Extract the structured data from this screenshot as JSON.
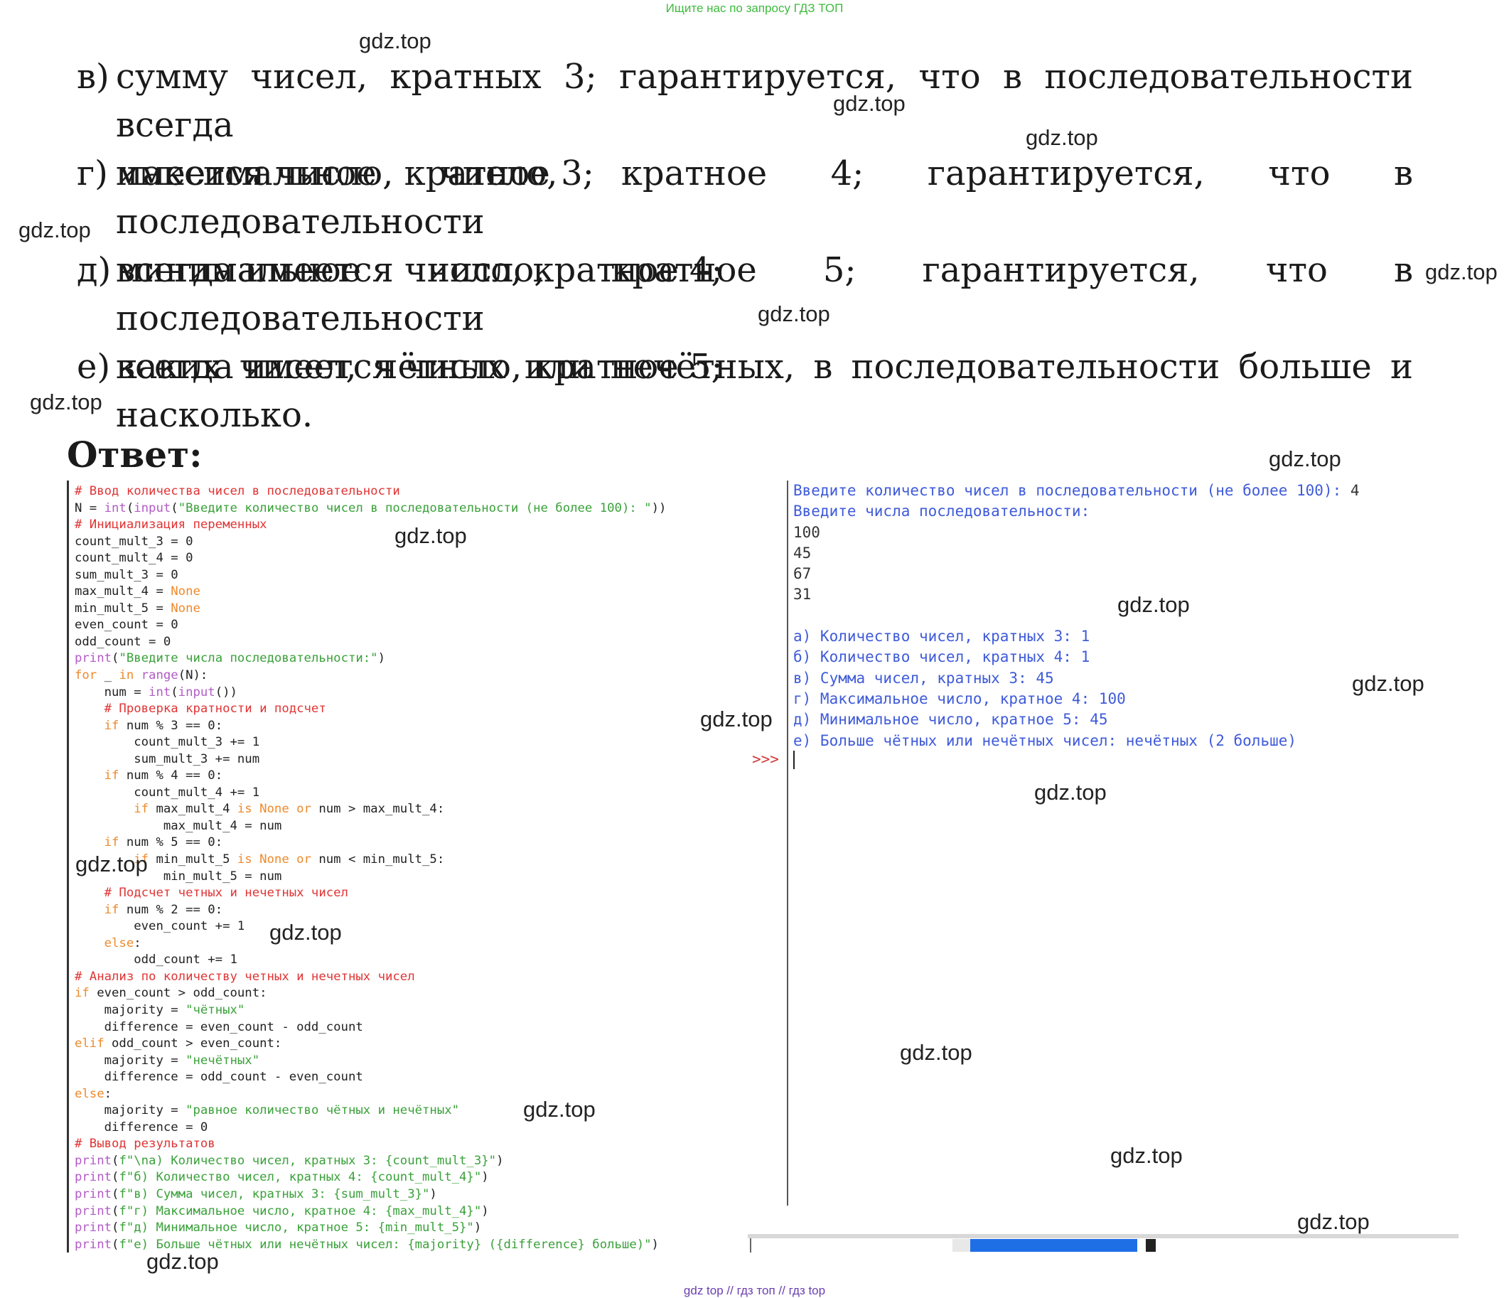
{
  "banner": "Ищите нас по запросу ГДЗ ТОП",
  "tasks": [
    {
      "label": "в)",
      "line1": "сумму чисел, кратных 3; гарантируется, что в последовательности всегда",
      "line2": "имеется число, кратное 3;"
    },
    {
      "label": "г)",
      "line1": "максимальное число, кратное 4; гарантируется, что в последовательности",
      "line2": "всегда имеется число, кратное 4;"
    },
    {
      "label": "д)",
      "line1": "минимальное число, кратное 5; гарантируется, что в последовательности",
      "line2": "всегда имеется число, кратное 5;"
    },
    {
      "label": "е)",
      "line1": "каких чисел, чётных или нечётных, в последовательности больше и",
      "line2": "насколько."
    }
  ],
  "answer_heading": "Ответ:",
  "code": [
    [
      {
        "t": "# Ввод количества чисел в последовательности",
        "c": "com"
      }
    ],
    [
      {
        "t": "N = ",
        "c": ""
      },
      {
        "t": "int",
        "c": "bi"
      },
      {
        "t": "(",
        "c": ""
      },
      {
        "t": "input",
        "c": "bi"
      },
      {
        "t": "(",
        "c": ""
      },
      {
        "t": "\"Введите количество чисел в последовательности (не более 100): \"",
        "c": "str"
      },
      {
        "t": "))",
        "c": ""
      }
    ],
    [
      {
        "t": "# Инициализация переменных",
        "c": "com"
      }
    ],
    [
      {
        "t": "count_mult_3 = 0",
        "c": ""
      }
    ],
    [
      {
        "t": "count_mult_4 = 0",
        "c": ""
      }
    ],
    [
      {
        "t": "sum_mult_3 = 0",
        "c": ""
      }
    ],
    [
      {
        "t": "max_mult_4 = ",
        "c": ""
      },
      {
        "t": "None",
        "c": "none"
      }
    ],
    [
      {
        "t": "min_mult_5 = ",
        "c": ""
      },
      {
        "t": "None",
        "c": "none"
      }
    ],
    [
      {
        "t": "even_count = 0",
        "c": ""
      }
    ],
    [
      {
        "t": "odd_count = 0",
        "c": ""
      }
    ],
    [
      {
        "t": "print",
        "c": "bi"
      },
      {
        "t": "(",
        "c": ""
      },
      {
        "t": "\"Введите числа последовательности:\"",
        "c": "str"
      },
      {
        "t": ")",
        "c": ""
      }
    ],
    [
      {
        "t": "for",
        "c": "kw"
      },
      {
        "t": " _ ",
        "c": ""
      },
      {
        "t": "in",
        "c": "kw"
      },
      {
        "t": " ",
        "c": ""
      },
      {
        "t": "range",
        "c": "bi"
      },
      {
        "t": "(N):",
        "c": ""
      }
    ],
    [
      {
        "t": "    num = ",
        "c": ""
      },
      {
        "t": "int",
        "c": "bi"
      },
      {
        "t": "(",
        "c": ""
      },
      {
        "t": "input",
        "c": "bi"
      },
      {
        "t": "())",
        "c": ""
      }
    ],
    [
      {
        "t": "    # Проверка кратности и подсчет",
        "c": "com"
      }
    ],
    [
      {
        "t": "    ",
        "c": ""
      },
      {
        "t": "if",
        "c": "kw"
      },
      {
        "t": " num % 3 == 0:",
        "c": ""
      }
    ],
    [
      {
        "t": "        count_mult_3 += 1",
        "c": ""
      }
    ],
    [
      {
        "t": "        sum_mult_3 += num",
        "c": ""
      }
    ],
    [
      {
        "t": "    ",
        "c": ""
      },
      {
        "t": "if",
        "c": "kw"
      },
      {
        "t": " num % 4 == 0:",
        "c": ""
      }
    ],
    [
      {
        "t": "        count_mult_4 += 1",
        "c": ""
      }
    ],
    [
      {
        "t": "        ",
        "c": ""
      },
      {
        "t": "if",
        "c": "kw"
      },
      {
        "t": " max_mult_4 ",
        "c": ""
      },
      {
        "t": "is None or",
        "c": "kw"
      },
      {
        "t": " num > max_mult_4:",
        "c": ""
      }
    ],
    [
      {
        "t": "            max_mult_4 = num",
        "c": ""
      }
    ],
    [
      {
        "t": "    ",
        "c": ""
      },
      {
        "t": "if",
        "c": "kw"
      },
      {
        "t": " num % 5 == 0:",
        "c": ""
      }
    ],
    [
      {
        "t": "        ",
        "c": ""
      },
      {
        "t": "if",
        "c": "kw"
      },
      {
        "t": " min_mult_5 ",
        "c": ""
      },
      {
        "t": "is None or",
        "c": "kw"
      },
      {
        "t": " num < min_mult_5:",
        "c": ""
      }
    ],
    [
      {
        "t": "            min_mult_5 = num",
        "c": ""
      }
    ],
    [
      {
        "t": "    # Подсчет четных и нечетных чисел",
        "c": "com"
      }
    ],
    [
      {
        "t": "    ",
        "c": ""
      },
      {
        "t": "if",
        "c": "kw"
      },
      {
        "t": " num % 2 == 0:",
        "c": ""
      }
    ],
    [
      {
        "t": "        even_count += 1",
        "c": ""
      }
    ],
    [
      {
        "t": "    ",
        "c": ""
      },
      {
        "t": "else",
        "c": "kw"
      },
      {
        "t": ":",
        "c": ""
      }
    ],
    [
      {
        "t": "        odd_count += 1",
        "c": ""
      }
    ],
    [
      {
        "t": "# Анализ по количеству четных и нечетных чисел",
        "c": "com"
      }
    ],
    [
      {
        "t": "if",
        "c": "kw"
      },
      {
        "t": " even_count > odd_count:",
        "c": ""
      }
    ],
    [
      {
        "t": "    majority = ",
        "c": ""
      },
      {
        "t": "\"чётных\"",
        "c": "str"
      }
    ],
    [
      {
        "t": "    difference = even_count - odd_count",
        "c": ""
      }
    ],
    [
      {
        "t": "elif",
        "c": "kw"
      },
      {
        "t": " odd_count > even_count:",
        "c": ""
      }
    ],
    [
      {
        "t": "    majority = ",
        "c": ""
      },
      {
        "t": "\"нечётных\"",
        "c": "str"
      }
    ],
    [
      {
        "t": "    difference = odd_count - even_count",
        "c": ""
      }
    ],
    [
      {
        "t": "else",
        "c": "kw"
      },
      {
        "t": ":",
        "c": ""
      }
    ],
    [
      {
        "t": "    majority = ",
        "c": ""
      },
      {
        "t": "\"равное количество чётных и нечётных\"",
        "c": "str"
      }
    ],
    [
      {
        "t": "    difference = 0",
        "c": ""
      }
    ],
    [
      {
        "t": "# Вывод результатов",
        "c": "com"
      }
    ],
    [
      {
        "t": "print",
        "c": "bi"
      },
      {
        "t": "(",
        "c": ""
      },
      {
        "t": "f\"\\na) Количество чисел, кратных 3: {count_mult_3}\"",
        "c": "str"
      },
      {
        "t": ")",
        "c": ""
      }
    ],
    [
      {
        "t": "print",
        "c": "bi"
      },
      {
        "t": "(",
        "c": ""
      },
      {
        "t": "f\"б) Количество чисел, кратных 4: {count_mult_4}\"",
        "c": "str"
      },
      {
        "t": ")",
        "c": ""
      }
    ],
    [
      {
        "t": "print",
        "c": "bi"
      },
      {
        "t": "(",
        "c": ""
      },
      {
        "t": "f\"в) Сумма чисел, кратных 3: {sum_mult_3}\"",
        "c": "str"
      },
      {
        "t": ")",
        "c": ""
      }
    ],
    [
      {
        "t": "print",
        "c": "bi"
      },
      {
        "t": "(",
        "c": ""
      },
      {
        "t": "f\"г) Максимальное число, кратное 4: {max_mult_4}\"",
        "c": "str"
      },
      {
        "t": ")",
        "c": ""
      }
    ],
    [
      {
        "t": "print",
        "c": "bi"
      },
      {
        "t": "(",
        "c": ""
      },
      {
        "t": "f\"д) Минимальное число, кратное 5: {min_mult_5}\"",
        "c": "str"
      },
      {
        "t": ")",
        "c": ""
      }
    ],
    [
      {
        "t": "print",
        "c": "bi"
      },
      {
        "t": "(",
        "c": ""
      },
      {
        "t": "f\"е) Больше чётных или нечётных чисел: {majority} ({difference} больше)\"",
        "c": "str"
      },
      {
        "t": ")",
        "c": ""
      }
    ]
  ],
  "shell": [
    [
      {
        "t": "Введите количество чисел в последовательности (не более 100): ",
        "c": "blue"
      },
      {
        "t": "4",
        "c": "black"
      }
    ],
    [
      {
        "t": "Введите числа последовательности:",
        "c": "blue"
      }
    ],
    [
      {
        "t": "100",
        "c": "black"
      }
    ],
    [
      {
        "t": "45",
        "c": "black"
      }
    ],
    [
      {
        "t": "67",
        "c": "black"
      }
    ],
    [
      {
        "t": "31",
        "c": "black"
      }
    ],
    [
      {
        "t": "",
        "c": "blue"
      }
    ],
    [
      {
        "t": "а) Количество чисел, кратных 3: 1",
        "c": "blue"
      }
    ],
    [
      {
        "t": "б) Количество чисел, кратных 4: 1",
        "c": "blue"
      }
    ],
    [
      {
        "t": "в) Сумма чисел, кратных 3: 45",
        "c": "blue"
      }
    ],
    [
      {
        "t": "г) Максимальное число, кратное 4: 100",
        "c": "blue"
      }
    ],
    [
      {
        "t": "д) Минимальное число, кратное 5: 45",
        "c": "blue"
      }
    ],
    [
      {
        "t": "е) Больше чётных или нечётных чисел: нечётных (2 больше)",
        "c": "blue"
      }
    ]
  ],
  "shell_prompt": ">>>",
  "watermark": "gdz.top",
  "footer": "gdz top  //  гдз топ  //  гдз top"
}
